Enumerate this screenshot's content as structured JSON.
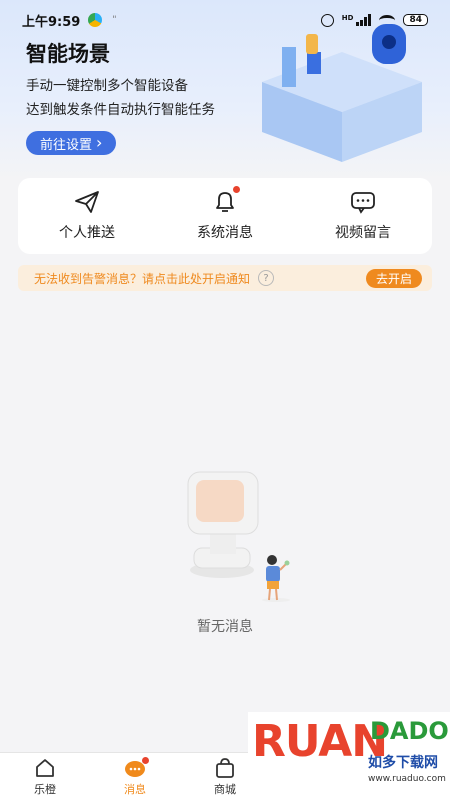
{
  "status_bar": {
    "time": "上午9:59",
    "small_indicator": "\"",
    "hd_label": "HD",
    "battery": "84"
  },
  "hero": {
    "title": "智能场景",
    "line1": "手动一键控制多个智能设备",
    "line2": "达到触发条件自动执行智能任务",
    "button_label": "前往设置",
    "button_chevron": "›",
    "accent_color": "#3f6fe0"
  },
  "actions": [
    {
      "label": "个人推送",
      "icon": "paper-plane-icon"
    },
    {
      "label": "系统消息",
      "icon": "bell-icon",
      "has_badge": true
    },
    {
      "label": "视频留言",
      "icon": "chat-bubble-icon"
    }
  ],
  "notice": {
    "text": "无法收到告警消息？请点击此处开启通知",
    "help_symbol": "?",
    "button_label": "去开启",
    "color": "#ef8a1f"
  },
  "empty_state": {
    "text": "暂无消息"
  },
  "tabbar": {
    "tabs": [
      {
        "label": "乐橙",
        "icon": "home-icon",
        "active": false
      },
      {
        "label": "消息",
        "icon": "message-icon",
        "active": true
      },
      {
        "label": "商城",
        "icon": "shopping-bag-icon",
        "active": false
      }
    ],
    "active_color": "#f08a1c"
  },
  "watermark": {
    "big": "RUAN",
    "small": "DADO",
    "cn": "如多下载网",
    "url": "www.ruaduo.com"
  }
}
